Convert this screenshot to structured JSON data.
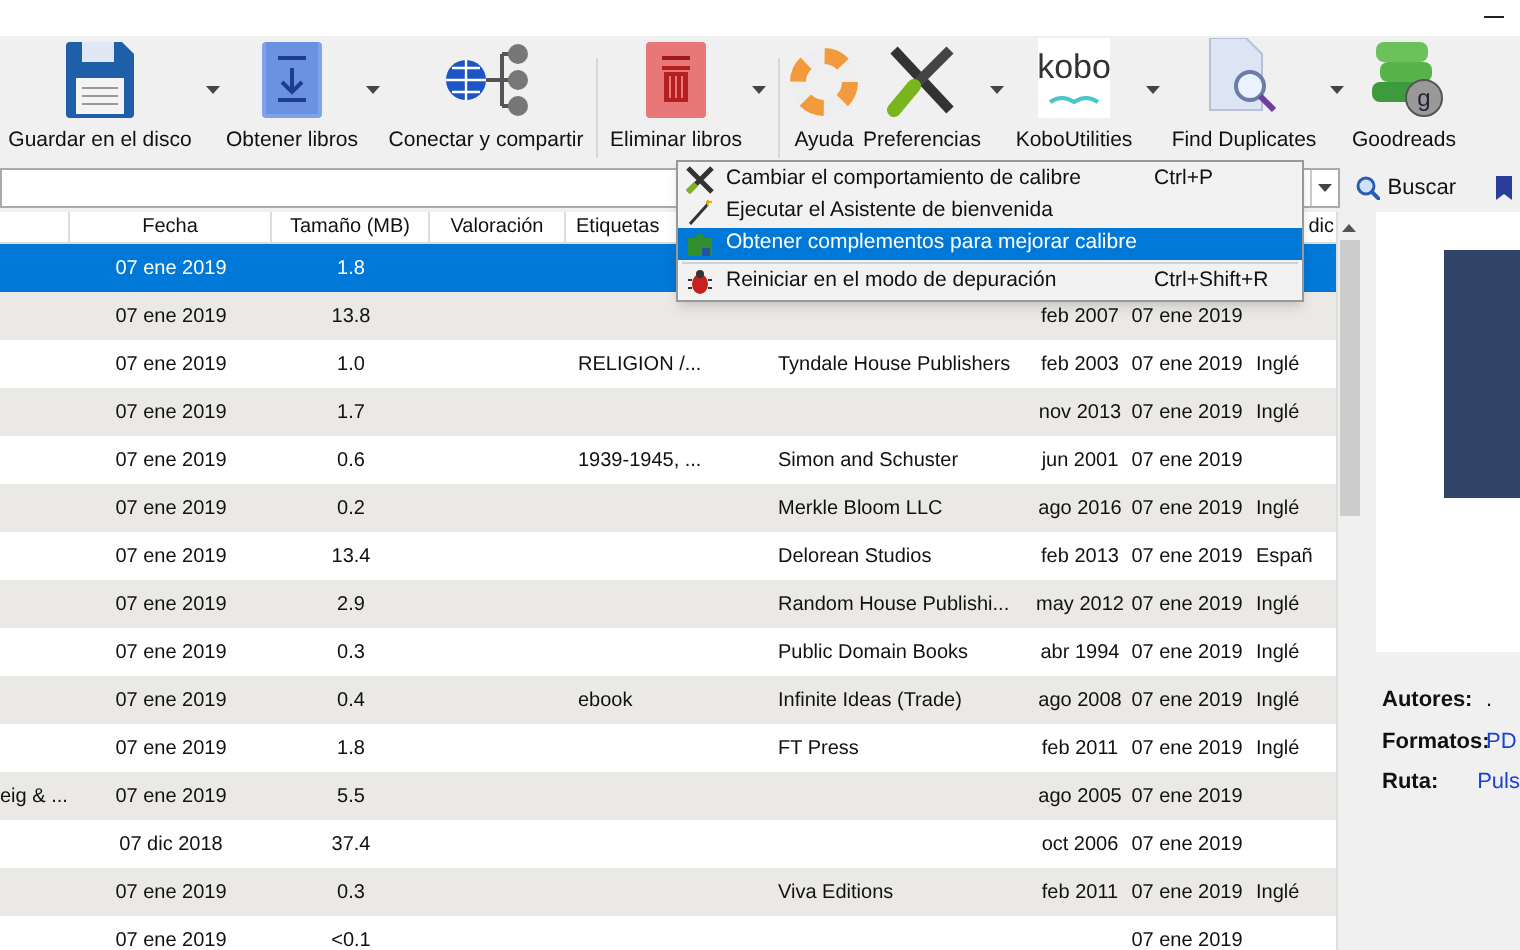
{
  "toolbar": [
    {
      "label": "Guardar en el disco",
      "dropdown": true
    },
    {
      "label": "Obtener libros",
      "dropdown": true
    },
    {
      "label": "Conectar y compartir",
      "dropdown": false
    },
    {
      "label": "Eliminar libros",
      "dropdown": true
    },
    {
      "label": "Ayuda",
      "dropdown": false
    },
    {
      "label": "Preferencias",
      "dropdown": true
    },
    {
      "label": "KoboUtilities",
      "dropdown": true,
      "logo_text": "kobo"
    },
    {
      "label": "Find Duplicates",
      "dropdown": true
    },
    {
      "label": "Goodreads",
      "dropdown": false,
      "badge": "g"
    }
  ],
  "search": {
    "button": "Buscar"
  },
  "table": {
    "columns": [
      "",
      "Fecha",
      "Tamaño (MB)",
      "Valoración",
      "Etiquetas",
      "",
      "",
      "",
      "dic"
    ],
    "rows": [
      {
        "selected": true,
        "cells": [
          "",
          "07 ene 2019",
          "1.8",
          "",
          "",
          "",
          "",
          "",
          ""
        ]
      },
      {
        "selected": false,
        "cells": [
          "",
          "07 ene 2019",
          "13.8",
          "",
          "",
          "",
          "feb 2007",
          "07 ene 2019",
          ""
        ]
      },
      {
        "selected": false,
        "cells": [
          "",
          "07 ene 2019",
          "1.0",
          "",
          "RELIGION /...",
          "Tyndale House Publishers",
          "feb 2003",
          "07 ene 2019",
          "Inglé"
        ]
      },
      {
        "selected": false,
        "cells": [
          "",
          "07 ene 2019",
          "1.7",
          "",
          "",
          "",
          "nov 2013",
          "07 ene 2019",
          "Inglé"
        ]
      },
      {
        "selected": false,
        "cells": [
          "",
          "07 ene 2019",
          "0.6",
          "",
          "1939-1945, ...",
          "Simon and Schuster",
          "jun 2001",
          "07 ene 2019",
          ""
        ]
      },
      {
        "selected": false,
        "cells": [
          "",
          "07 ene 2019",
          "0.2",
          "",
          "",
          "Merkle Bloom LLC",
          "ago 2016",
          "07 ene 2019",
          "Inglé"
        ]
      },
      {
        "selected": false,
        "cells": [
          "",
          "07 ene 2019",
          "13.4",
          "",
          "",
          "Delorean Studios",
          "feb 2013",
          "07 ene 2019",
          "Españ"
        ]
      },
      {
        "selected": false,
        "cells": [
          "",
          "07 ene 2019",
          "2.9",
          "",
          "",
          "Random House Publishi...",
          "may 2012",
          "07 ene 2019",
          "Inglé"
        ]
      },
      {
        "selected": false,
        "cells": [
          "",
          "07 ene 2019",
          "0.3",
          "",
          "",
          "Public Domain Books",
          "abr 1994",
          "07 ene 2019",
          "Inglé"
        ]
      },
      {
        "selected": false,
        "cells": [
          "",
          "07 ene 2019",
          "0.4",
          "",
          "ebook",
          "Infinite Ideas (Trade)",
          "ago 2008",
          "07 ene 2019",
          "Inglé"
        ]
      },
      {
        "selected": false,
        "cells": [
          "",
          "07 ene 2019",
          "1.8",
          "",
          "",
          "FT Press",
          "feb 2011",
          "07 ene 2019",
          "Inglé"
        ]
      },
      {
        "selected": false,
        "cells": [
          "eig & ...",
          "07 ene 2019",
          "5.5",
          "",
          "",
          "",
          "ago 2005",
          "07 ene 2019",
          ""
        ]
      },
      {
        "selected": false,
        "cells": [
          "",
          "07 dic 2018",
          "37.4",
          "",
          "",
          "",
          "oct 2006",
          "07 ene 2019",
          ""
        ]
      },
      {
        "selected": false,
        "cells": [
          "",
          "07 ene 2019",
          "0.3",
          "",
          "",
          "Viva Editions",
          "feb 2011",
          "07 ene 2019",
          "Inglé"
        ]
      },
      {
        "selected": false,
        "cells": [
          "",
          "07 ene 2019",
          "<0.1",
          "",
          "",
          "",
          "",
          "07 ene 2019",
          ""
        ]
      }
    ]
  },
  "menu": [
    {
      "label": "Cambiar el comportamiento de calibre",
      "shortcut": "Ctrl+P",
      "selected": false
    },
    {
      "label": "Ejecutar el Asistente de bienvenida",
      "selected": false
    },
    {
      "label": "Obtener complementos para mejorar calibre",
      "selected": true
    },
    {
      "label": "Reiniciar en el modo de depuración",
      "shortcut": "Ctrl+Shift+R",
      "selected": false
    }
  ],
  "details": [
    {
      "label": "Autores:",
      "value": "."
    },
    {
      "label": "Formatos:",
      "value": "PD"
    },
    {
      "label": "Ruta:",
      "value": "Puls"
    }
  ]
}
